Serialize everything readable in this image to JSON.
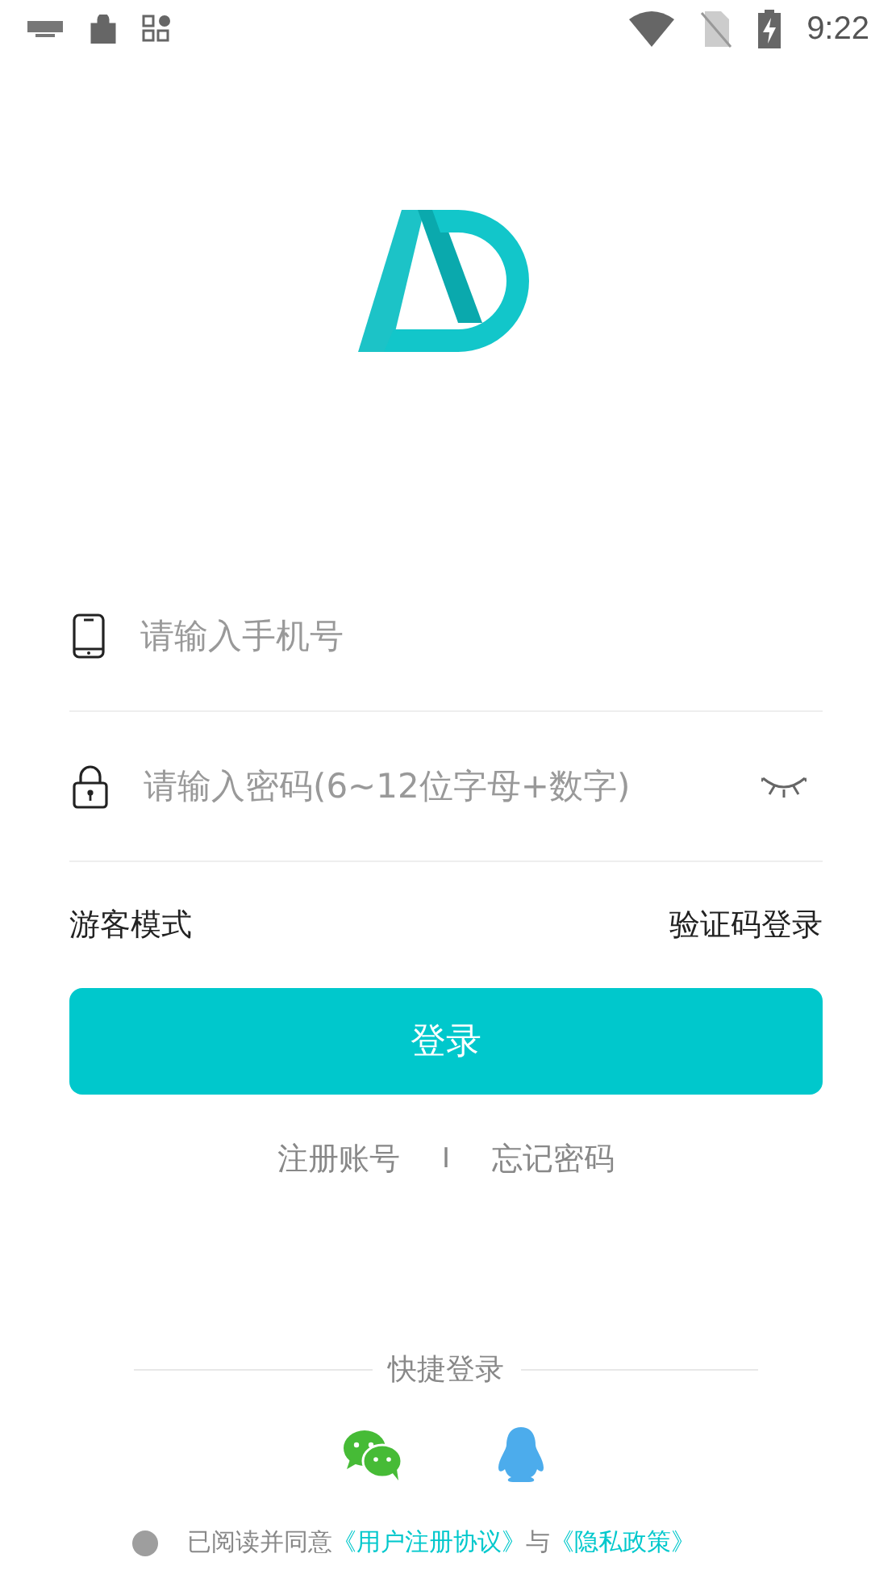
{
  "status_bar": {
    "time": "9:22"
  },
  "phone_field": {
    "placeholder": "请输入手机号"
  },
  "password_field": {
    "placeholder": "请输入密码(6~12位字母+数字)",
    "visible": false
  },
  "links": {
    "guest": "游客模式",
    "code_login": "验证码登录"
  },
  "login_button": "登录",
  "account_links": {
    "register": "注册账号",
    "separator": "I",
    "forgot": "忘记密码"
  },
  "quick_login": {
    "title": "快捷登录",
    "providers": [
      {
        "kind": "wechat"
      },
      {
        "kind": "qq"
      }
    ]
  },
  "agreement": {
    "checked": false,
    "text": "已阅读并同意",
    "terms": "《用户注册协议》",
    "and": "与",
    "privacy": "《隐私政策》"
  }
}
